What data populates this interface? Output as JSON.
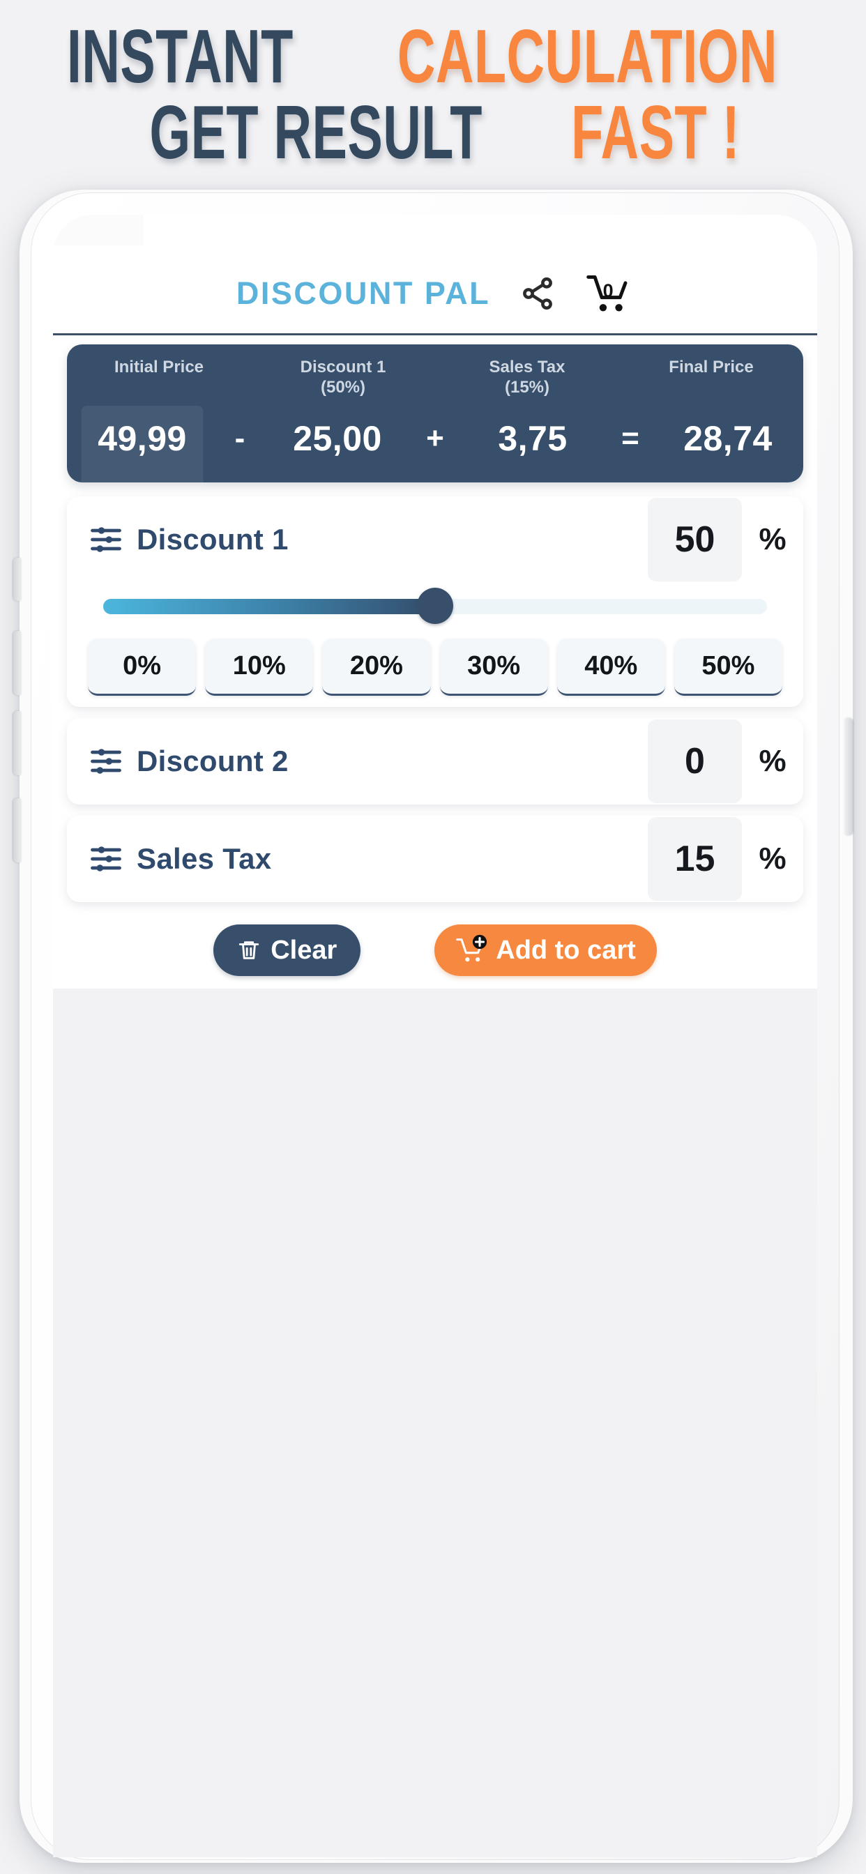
{
  "headline": {
    "line1_part1": "INSTANT",
    "line1_part2": "CALCULATION",
    "line2_part1": "GET RESULT",
    "line2_part2": "FAST !",
    "dark_color": "#34495e",
    "accent_color": "#f9863f"
  },
  "app": {
    "title": "DISCOUNT PAL",
    "title_color": "#5bb3db",
    "share_icon": "share-icon",
    "cart_icon": "shopping-cart-icon",
    "cart_count": "0"
  },
  "summary": {
    "columns": [
      {
        "label": "Initial Price",
        "sub": ""
      },
      {
        "label": "Discount 1",
        "sub": "(50%)"
      },
      {
        "label": "Sales Tax",
        "sub": "(15%)"
      },
      {
        "label": "Final Price",
        "sub": ""
      }
    ],
    "initial_price": "49,99",
    "op1": "-",
    "discount_amount": "25,00",
    "op2": "+",
    "tax_amount": "3,75",
    "op3": "=",
    "final_price": "28,74",
    "panel_color": "#374f6b"
  },
  "discount1": {
    "icon": "sliders-icon",
    "label": "Discount 1",
    "value": "50",
    "unit": "%",
    "slider_percent": 50,
    "quick_buttons": [
      "0%",
      "10%",
      "20%",
      "30%",
      "40%",
      "50%"
    ]
  },
  "discount2": {
    "icon": "sliders-icon",
    "label": "Discount 2",
    "value": "0",
    "unit": "%"
  },
  "sales_tax": {
    "icon": "sliders-icon",
    "label": "Sales Tax",
    "value": "15",
    "unit": "%"
  },
  "actions": {
    "clear_label": "Clear",
    "clear_icon": "trash-icon",
    "clear_color": "#374f6b",
    "cart_label": "Add to cart",
    "cart_icon": "cart-plus-icon",
    "cart_color": "#f7883f"
  }
}
